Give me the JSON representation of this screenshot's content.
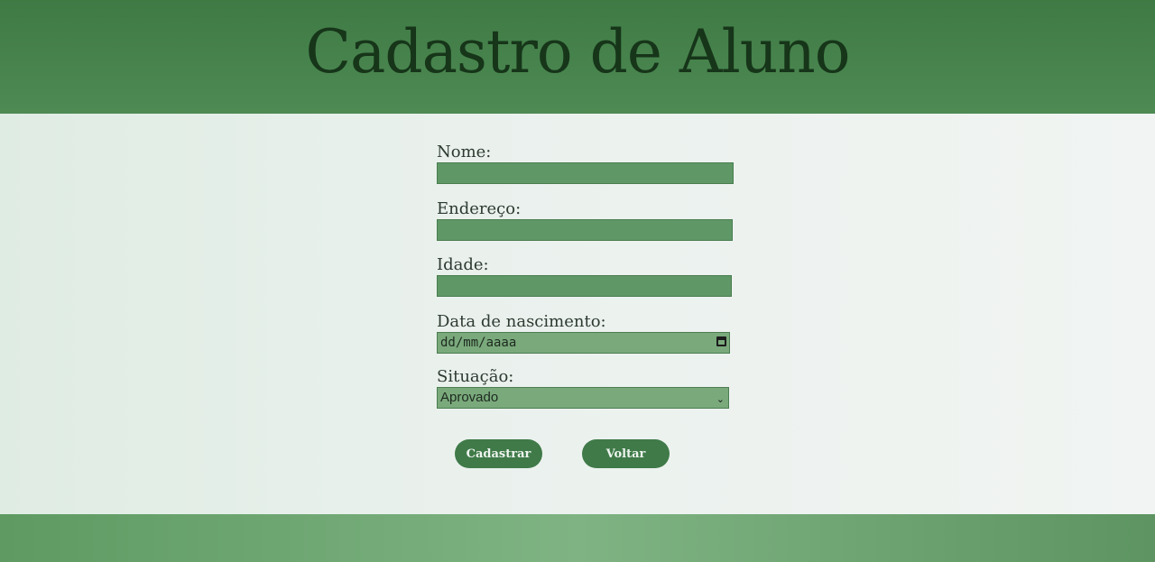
{
  "header": {
    "title": "Cadastro de Aluno"
  },
  "form": {
    "nome": {
      "label": "Nome:",
      "value": ""
    },
    "endereco": {
      "label": "Endereço:",
      "value": ""
    },
    "idade": {
      "label": "Idade:",
      "value": ""
    },
    "data_nascimento": {
      "label": "Data de nascimento:",
      "placeholder": "dd/mm/aaaa",
      "icon": "calendar-icon"
    },
    "situacao": {
      "label": "Situação:",
      "selected": "Aprovado",
      "icon": "chevron-down-icon"
    }
  },
  "buttons": {
    "cadastrar": "Cadastrar",
    "voltar": "Voltar"
  },
  "colors": {
    "header_bg": "#4e8a53",
    "title_text": "#163519",
    "field_bg": "#5f9866",
    "button_bg": "#3f7a48",
    "footer_bg": "#7fb383"
  }
}
